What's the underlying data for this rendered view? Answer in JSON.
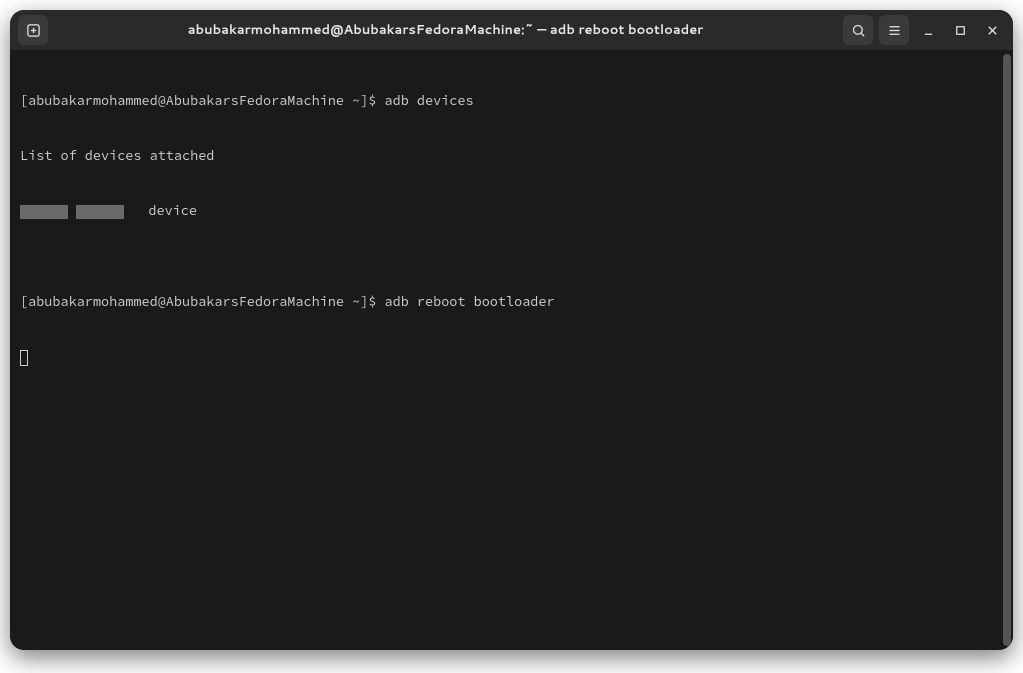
{
  "titlebar": {
    "title": "abubakarmohammed@AbubakarsFedoraMachine:~ — adb reboot bootloader"
  },
  "terminal": {
    "line1_prompt": "[abubakarmohammed@AbubakarsFedoraMachine ~]$ ",
    "line1_cmd": "adb devices",
    "line2": "List of devices attached",
    "line3_suffix": "   device",
    "line4": "",
    "line5_prompt": "[abubakarmohammed@AbubakarsFedoraMachine ~]$ ",
    "line5_cmd": "adb reboot bootloader"
  }
}
